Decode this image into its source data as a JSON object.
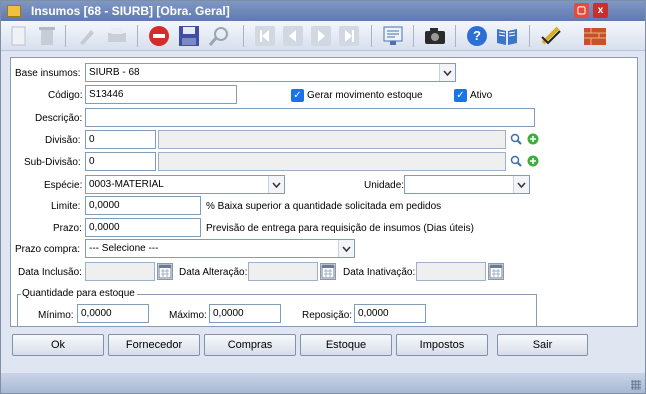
{
  "window": {
    "title": "Insumos [68 - SIURB] [Obra. Geral]",
    "min_label": "▢",
    "close_label": "x"
  },
  "form": {
    "base_insumos": {
      "label": "Base insumos:",
      "value": "SIURB - 68"
    },
    "codigo": {
      "label": "Código:",
      "value": "S13446"
    },
    "gerar_movimento": {
      "label": "Gerar movimento estoque",
      "checked": true
    },
    "ativo": {
      "label": "Ativo",
      "checked": true
    },
    "descricao": {
      "label": "Descrição:",
      "value": ""
    },
    "divisao": {
      "label": "Divisão:",
      "value": "0",
      "desc": ""
    },
    "sub_divisao": {
      "label": "Sub-Divisão:",
      "value": "0",
      "desc": ""
    },
    "especie": {
      "label": "Espécie:",
      "value": "0003-MATERIAL"
    },
    "unidade": {
      "label": "Unidade:",
      "value": ""
    },
    "limite": {
      "label": "Limite:",
      "value": "0,0000",
      "hint": "% Baixa superior a quantidade solicitada em pedidos"
    },
    "prazo": {
      "label": "Prazo:",
      "value": "0,0000",
      "hint": "Previsão de entrega para requisição de insumos (Dias úteis)"
    },
    "prazo_compra": {
      "label": "Prazo compra:",
      "value": "--- Selecione ---"
    },
    "data_inclusao": {
      "label": "Data Inclusão:",
      "value": ""
    },
    "data_alteracao": {
      "label": "Data Alteração:",
      "value": ""
    },
    "data_inativacao": {
      "label": "Data Inativação:",
      "value": ""
    },
    "quantidade": {
      "legend": "Quantidade para estoque",
      "minimo": {
        "label": "Mínimo:",
        "value": "0,0000"
      },
      "maximo": {
        "label": "Máximo:",
        "value": "0,0000"
      },
      "reposicao": {
        "label": "Reposição:",
        "value": "0,0000"
      }
    }
  },
  "buttons": {
    "ok": "Ok",
    "fornecedor": "Fornecedor",
    "compras": "Compras",
    "estoque": "Estoque",
    "impostos": "Impostos",
    "sair": "Sair"
  },
  "colors": {
    "titlebar": "#6b86bb",
    "check": "#1a73e8",
    "stop": "#d42b2b",
    "help": "#2b6fd6"
  }
}
